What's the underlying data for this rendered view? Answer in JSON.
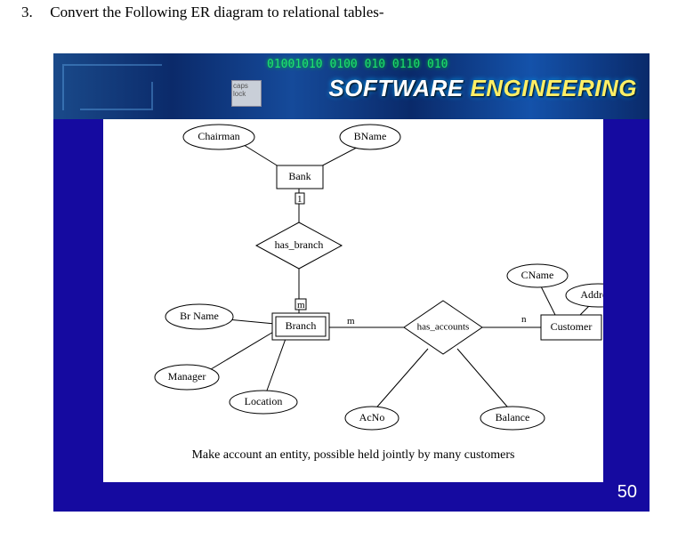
{
  "question": {
    "number": "3.",
    "text": "Convert the Following ER diagram to relational tables-"
  },
  "banner": {
    "title_pre": "SOFTWARE ",
    "title_post": "ENGINEERING",
    "key_label": "caps\nlock",
    "binary": "01001010\n0100 010\n0110 010"
  },
  "diagram": {
    "entities": {
      "bank": "Bank",
      "branch": "Branch",
      "customer": "Customer"
    },
    "relationships": {
      "has_branch": "has_branch",
      "has_accounts": "has_accounts"
    },
    "attributes": {
      "chairman": "Chairman",
      "bname": "BName",
      "brname": "Br Name",
      "manager": "Manager",
      "location": "Location",
      "cname": "CName",
      "address": "Address",
      "acno": "AcNo",
      "balance": "Balance"
    },
    "cardinality": {
      "one": "1",
      "m1": "m",
      "m2": "m",
      "n": "n"
    },
    "caption": "Make account an entity, possible held jointly by many customers"
  },
  "page_number": "50"
}
